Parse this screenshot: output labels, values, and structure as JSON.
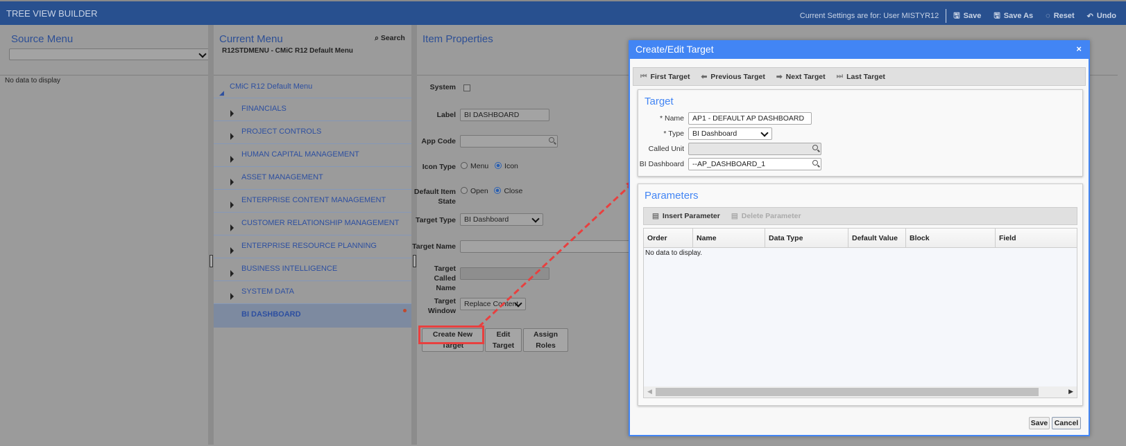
{
  "header": {
    "title": "TREE VIEW BUILDER",
    "settings_text": "Current Settings are for: User MISTYR12",
    "save": "Save",
    "save_as": "Save As",
    "reset": "Reset",
    "undo": "Undo"
  },
  "source_menu": {
    "title": "Source Menu",
    "select_value": "",
    "empty": "No data to display"
  },
  "current_menu": {
    "title": "Current Menu",
    "search": "Search",
    "subtitle": "R12STDMENU - CMiC R12 Default Menu",
    "root": "CMiC R12 Default Menu",
    "items": [
      "FINANCIALS",
      "PROJECT CONTROLS",
      "HUMAN CAPITAL MANAGEMENT",
      "ASSET MANAGEMENT",
      "ENTERPRISE CONTENT MANAGEMENT",
      "CUSTOMER RELATIONSHIP MANAGEMENT",
      "ENTERPRISE RESOURCE PLANNING",
      "BUSINESS INTELLIGENCE",
      "SYSTEM DATA"
    ],
    "selected": "BI DASHBOARD"
  },
  "item_properties": {
    "title": "Item Properties",
    "system_label": "System",
    "system_checked": false,
    "label_label": "Label",
    "label_value": "BI DASHBOARD",
    "app_code_label": "App Code",
    "app_code_value": "",
    "icon_type_label": "Icon Type",
    "icon_type_options": [
      "Menu",
      "Icon"
    ],
    "icon_type_selected": "Icon",
    "default_state_label": "Default Item State",
    "state_options": [
      "Open",
      "Close"
    ],
    "state_selected": "Close",
    "target_type_label": "Target Type",
    "target_type_value": "BI Dashboard",
    "target_name_label": "Target Name",
    "target_name_value": "",
    "target_called_label": "Target Called Name",
    "target_called_value": "",
    "target_window_label": "Target Window",
    "target_window_value": "Replace Content",
    "create_new_target": "Create New Target",
    "edit_target": "Edit Target",
    "assign_roles": "Assign Roles"
  },
  "dialog": {
    "title": "Create/Edit Target",
    "close": "×",
    "nav": {
      "first": "First Target",
      "previous": "Previous Target",
      "next": "Next Target",
      "last": "Last Target"
    },
    "target": {
      "heading": "Target",
      "name_label": "* Name",
      "name_value": "AP1 - DEFAULT AP DASHBOARD",
      "type_label": "* Type",
      "type_value": "BI Dashboard",
      "called_unit_label": "Called Unit",
      "called_unit_value": "",
      "bi_dashboard_label": "BI Dashboard",
      "bi_dashboard_value": "--AP_DASHBOARD_1"
    },
    "parameters": {
      "heading": "Parameters",
      "insert": "Insert Parameter",
      "delete": "Delete Parameter",
      "columns": [
        "Order",
        "Name",
        "Data Type",
        "Default Value",
        "Block",
        "Field"
      ],
      "empty": "No data to display."
    },
    "save": "Save",
    "cancel": "Cancel"
  },
  "colors": {
    "header": "#28508f",
    "dialog_accent": "#4285f4",
    "highlight": "#e8403f"
  }
}
